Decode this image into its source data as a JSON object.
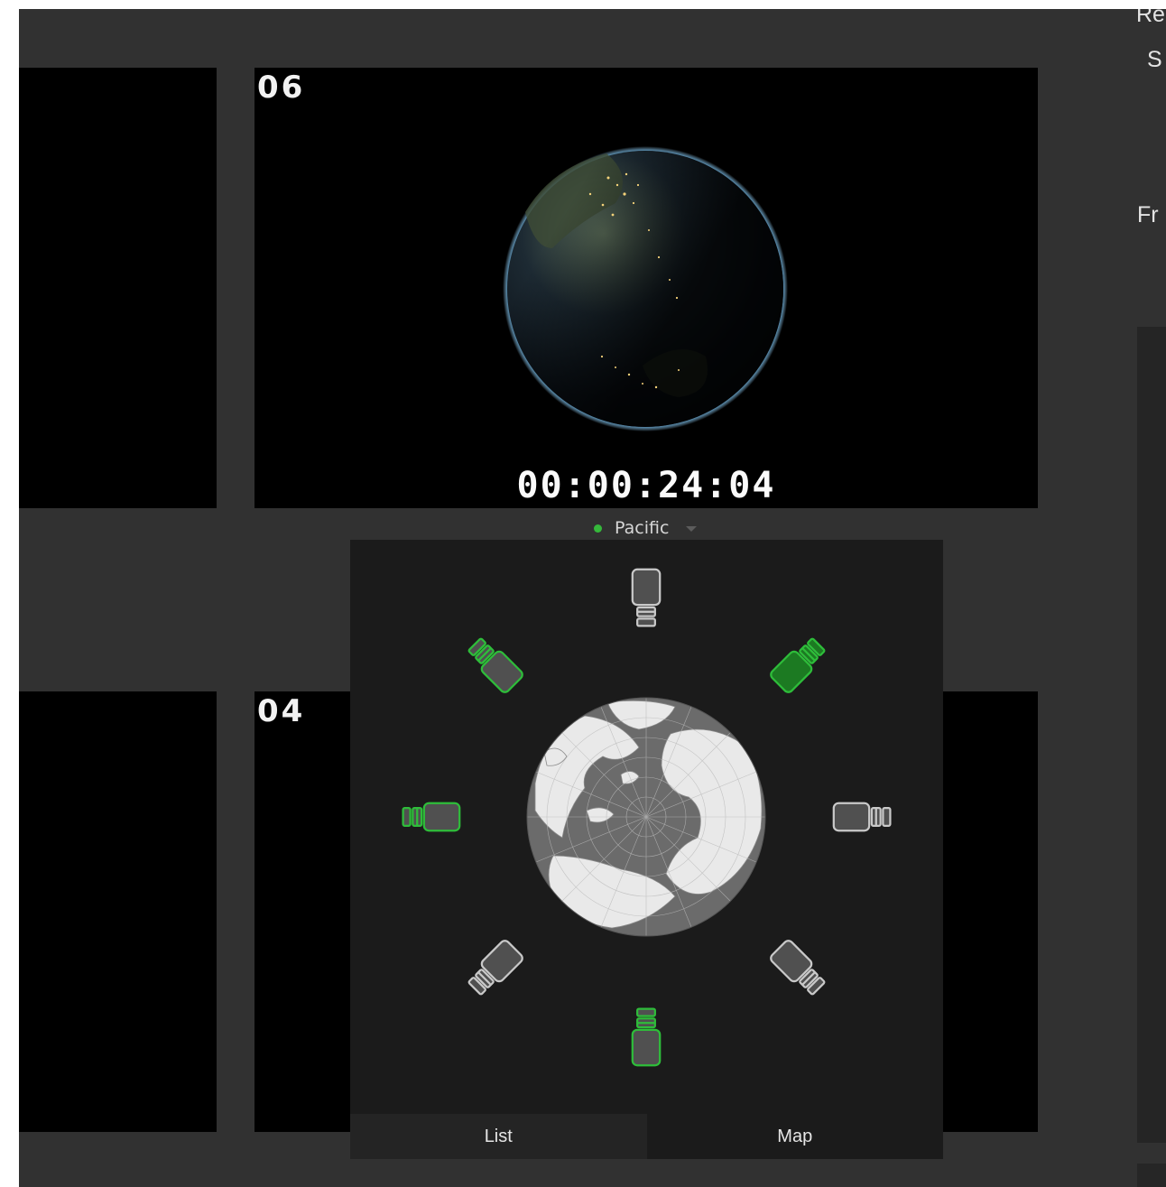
{
  "viewer": {
    "top_tile_label": "06",
    "bottom_tile_label": "04",
    "timecode": "00:00:24:04"
  },
  "right_panel": {
    "label_1": "Re",
    "label_2": "S",
    "label_3": "Fr"
  },
  "source": {
    "name": "Pacific",
    "status_color": "#35b83b"
  },
  "camera_popup": {
    "cameras": [
      {
        "id": "cam-top",
        "state": "inactive"
      },
      {
        "id": "cam-top-right",
        "state": "active"
      },
      {
        "id": "cam-right",
        "state": "inactive"
      },
      {
        "id": "cam-bottom-right",
        "state": "inactive"
      },
      {
        "id": "cam-bottom",
        "state": "selected"
      },
      {
        "id": "cam-bottom-left",
        "state": "inactive"
      },
      {
        "id": "cam-left",
        "state": "selected"
      },
      {
        "id": "cam-top-left",
        "state": "selected"
      }
    ],
    "tabs": [
      "List",
      "Map"
    ],
    "active_tab": "Map"
  },
  "colors": {
    "accent_green": "#2ebd3a",
    "active_fill": "#1c7a22",
    "panel_bg": "#1b1b1b",
    "app_bg": "#313131"
  }
}
